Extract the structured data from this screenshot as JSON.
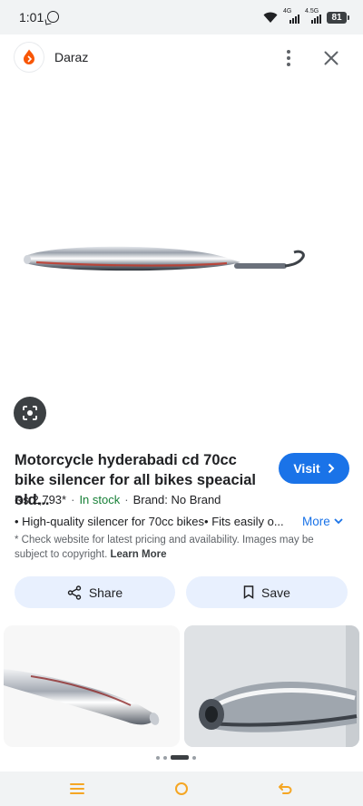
{
  "status_bar": {
    "time": "1:01",
    "network_1": "4G",
    "network_2": "4.5G",
    "battery": "81"
  },
  "header": {
    "site_name": "Daraz",
    "logo_icon": "daraz-logo",
    "more_icon": "more-vert-icon",
    "close_icon": "close-icon"
  },
  "hero": {
    "image_alt": "Chrome motorcycle silencer with red stripe",
    "lens_icon": "google-lens-icon"
  },
  "product": {
    "title": "Motorcycle hyderabadi cd 70cc bike silencer for all bikes speacial old...",
    "price": "Rs 2,793*",
    "stock": "In stock",
    "brand": "Brand: No Brand",
    "description": "• High-quality silencer for 70cc bikes• Fits easily o...",
    "more_label": "More",
    "visit_label": "Visit",
    "disclaimer_text": "* Check website for latest pricing and availability. Images may be subject to copyright.",
    "learn_more": "Learn More"
  },
  "actions": {
    "share_label": "Share",
    "save_label": "Save"
  },
  "colors": {
    "accent": "#1a73e8",
    "in_stock": "#188038",
    "button_bg": "#e8f0fe",
    "logo": "#f85606"
  },
  "pager": {
    "count": 4,
    "active_index": 2
  },
  "nav": {
    "menu_icon": "menu-icon",
    "home_icon": "home-circle-icon",
    "back_icon": "back-icon",
    "nav_color": "#f5a623"
  }
}
